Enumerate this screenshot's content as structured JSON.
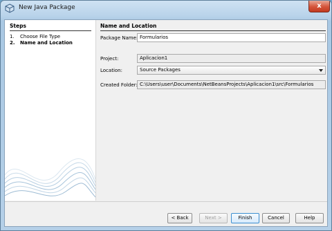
{
  "window": {
    "title": "New Java Package",
    "close_label": "x"
  },
  "steps": {
    "title": "Steps",
    "items": [
      {
        "num": "1.",
        "label": "Choose File Type"
      },
      {
        "num": "2.",
        "label": "Name and Location"
      }
    ]
  },
  "panel": {
    "title": "Name and Location",
    "package_name_label": "Package Name:",
    "package_name_value": "Formularios",
    "project_label": "Project:",
    "project_value": "Aplicacion1",
    "location_label": "Location:",
    "location_value": "Source Packages",
    "created_folder_label": "Created Folder:",
    "created_folder_value": "C:\\Users\\user\\Documents\\NetBeansProjects\\Aplicacion1\\src\\Formularios"
  },
  "buttons": {
    "back": "< Back",
    "next": "Next >",
    "finish": "Finish",
    "cancel": "Cancel",
    "help": "Help"
  }
}
